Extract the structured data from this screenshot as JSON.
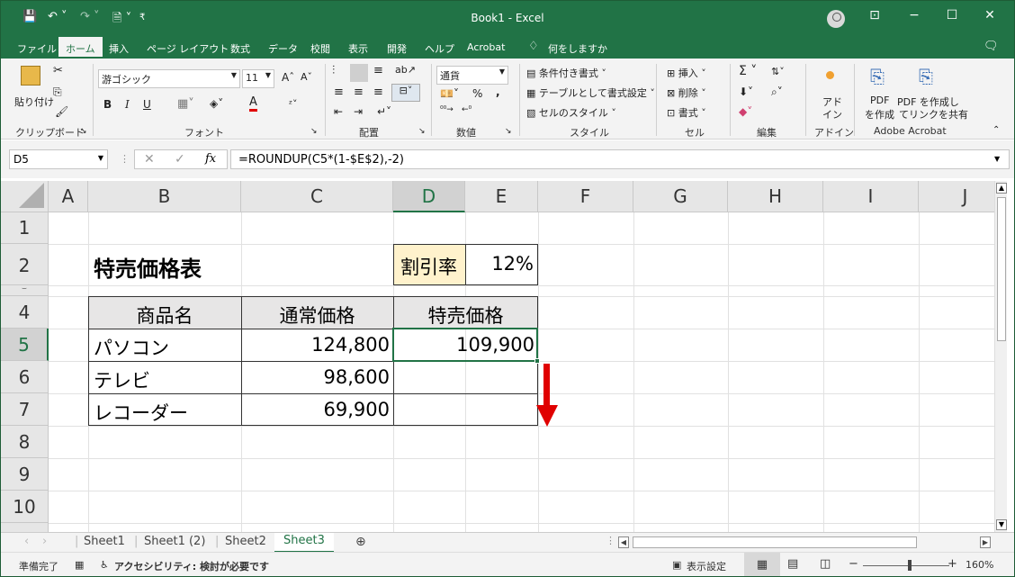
{
  "titlebar": {
    "title": "Book1  -  Excel",
    "save_icon": "💾",
    "undo_icon": "↶ ˅",
    "redo_icon": "↷ ˅",
    "touch_icon": "🗎 ˅",
    "qat_more": "₹"
  },
  "window_buttons": {
    "ribbon_display": "⊡",
    "minimize": "−",
    "maximize": "☐",
    "close": "✕"
  },
  "tabs": [
    "ファイル",
    "ホーム",
    "挿入",
    "ページ レイアウト",
    "数式",
    "データ",
    "校閲",
    "表示",
    "開発",
    "ヘルプ",
    "Acrobat"
  ],
  "tell_me": "何をしますか",
  "ribbon": {
    "clipboard": {
      "paste": "貼り付け",
      "label": "クリップボード"
    },
    "font": {
      "name": "游ゴシック",
      "size": "11",
      "grow": "Aˆ",
      "shrink": "Aˇ",
      "bold": "B",
      "italic": "I",
      "underline": "U",
      "label": "フォント"
    },
    "alignment": {
      "label": "配置"
    },
    "number": {
      "format": "通貨",
      "percent": "%",
      "comma": ",",
      "label": "数値"
    },
    "styles": {
      "conditional": "条件付き書式 ˅",
      "table": "テーブルとして書式設定 ˅",
      "cell_styles": "セルのスタイル ˅",
      "label": "スタイル"
    },
    "cells": {
      "insert": "挿入",
      "delete": "削除",
      "format": "書式",
      "label": "セル"
    },
    "editing": {
      "label": "編集"
    },
    "addins": {
      "name_line1": "アド",
      "name_line2": "イン",
      "label": "アドイン"
    },
    "acrobat": {
      "pdf1_line1": "PDF",
      "pdf1_line2": "を作成",
      "pdf2_line1": "PDF を作成し",
      "pdf2_line2": "てリンクを共有",
      "label": "Adobe Acrobat"
    }
  },
  "formula_bar": {
    "name_box": "D5",
    "cancel": "✕",
    "enter": "✓",
    "fx": "fx",
    "formula": "=ROUNDUP(C5*(1-$E$2),-2)"
  },
  "columns": [
    "A",
    "B",
    "C",
    "D",
    "E",
    "F",
    "G",
    "H",
    "I",
    "J"
  ],
  "rows": [
    "1",
    "2",
    "4",
    "5",
    "6",
    "7",
    "8",
    "9",
    "10"
  ],
  "sheet": {
    "title": "特売価格表",
    "discount_label": "割引率",
    "discount_value": "12%",
    "headers": [
      "商品名",
      "通常価格",
      "特売価格"
    ],
    "items": [
      {
        "name": "パソコン",
        "price": "124,800",
        "sale": "109,900"
      },
      {
        "name": "テレビ",
        "price": "98,600",
        "sale": ""
      },
      {
        "name": "レコーダー",
        "price": "69,900",
        "sale": ""
      }
    ]
  },
  "sheet_tabs": [
    "Sheet1",
    "Sheet1 (2)",
    "Sheet2",
    "Sheet3"
  ],
  "active_sheet": "Sheet3",
  "status": {
    "ready": "準備完了",
    "accessibility": "アクセシビリティ: 検討が必要です",
    "display_settings": "表示設定",
    "zoom": "160%",
    "zoom_minus": "−",
    "zoom_plus": "+"
  },
  "colors": {
    "excel_green": "#217346",
    "discount_fill": "#fff2cc",
    "arrow": "#e00000"
  }
}
